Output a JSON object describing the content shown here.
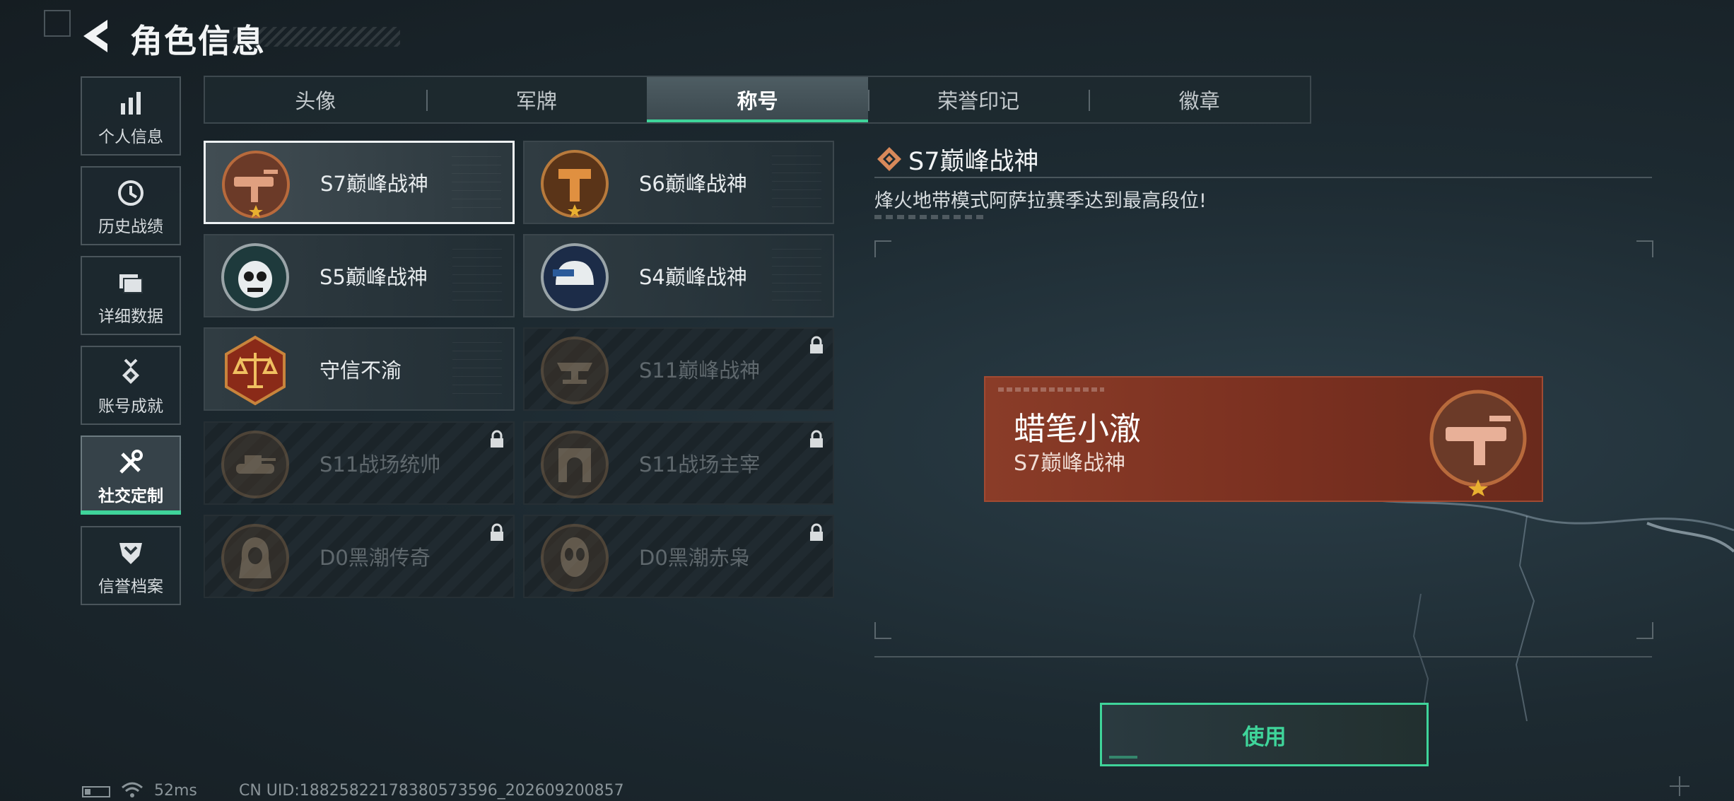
{
  "header": {
    "title": "角色信息"
  },
  "sidebar": {
    "items": [
      {
        "label": "个人信息",
        "icon": "bar-chart-icon"
      },
      {
        "label": "历史战绩",
        "icon": "history-clock-icon"
      },
      {
        "label": "详细数据",
        "icon": "folder-data-icon"
      },
      {
        "label": "账号成就",
        "icon": "achievement-medal-icon"
      },
      {
        "label": "社交定制",
        "icon": "tools-icon",
        "active": true
      },
      {
        "label": "信誉档案",
        "icon": "shield-badge-icon"
      }
    ]
  },
  "tabs": [
    {
      "label": "头像"
    },
    {
      "label": "军牌"
    },
    {
      "label": "称号",
      "active": true
    },
    {
      "label": "荣誉印记"
    },
    {
      "label": "徽章"
    }
  ],
  "titles": [
    {
      "name": "S7巅峰战神",
      "locked": false,
      "selected": true,
      "emblem": "smg-emblem-icon"
    },
    {
      "name": "S6巅峰战神",
      "locked": false,
      "emblem": "tower-emblem-icon"
    },
    {
      "name": "S5巅峰战神",
      "locked": false,
      "emblem": "skull-mask-emblem-icon"
    },
    {
      "name": "S4巅峰战神",
      "locked": false,
      "emblem": "helmet-emblem-icon"
    },
    {
      "name": "守信不渝",
      "locked": false,
      "emblem": "scales-emblem-icon"
    },
    {
      "name": "S11巅峰战神",
      "locked": true,
      "emblem": "anvil-emblem-icon"
    },
    {
      "name": "S11战场统帅",
      "locked": true,
      "emblem": "tank-emblem-icon"
    },
    {
      "name": "S11战场主宰",
      "locked": true,
      "emblem": "arch-emblem-icon"
    },
    {
      "name": "D0黑潮传奇",
      "locked": true,
      "emblem": "hooded-figure-emblem-icon"
    },
    {
      "name": "D0黑潮赤枭",
      "locked": true,
      "emblem": "alien-mask-emblem-icon"
    }
  ],
  "detail": {
    "title": "S7巅峰战神",
    "description": "烽火地带模式阿萨拉赛季达到最高段位!",
    "preview": {
      "player_name": "蜡笔小澈",
      "title": "S7巅峰战神"
    },
    "use_label": "使用"
  },
  "status": {
    "ping": "52ms",
    "uid": "CN UID:18825822178380573596_202609200857"
  },
  "colors": {
    "accent": "#3fd49a",
    "preview_bg": "#7a3020",
    "emblem_bronze": "#b86a3c"
  }
}
